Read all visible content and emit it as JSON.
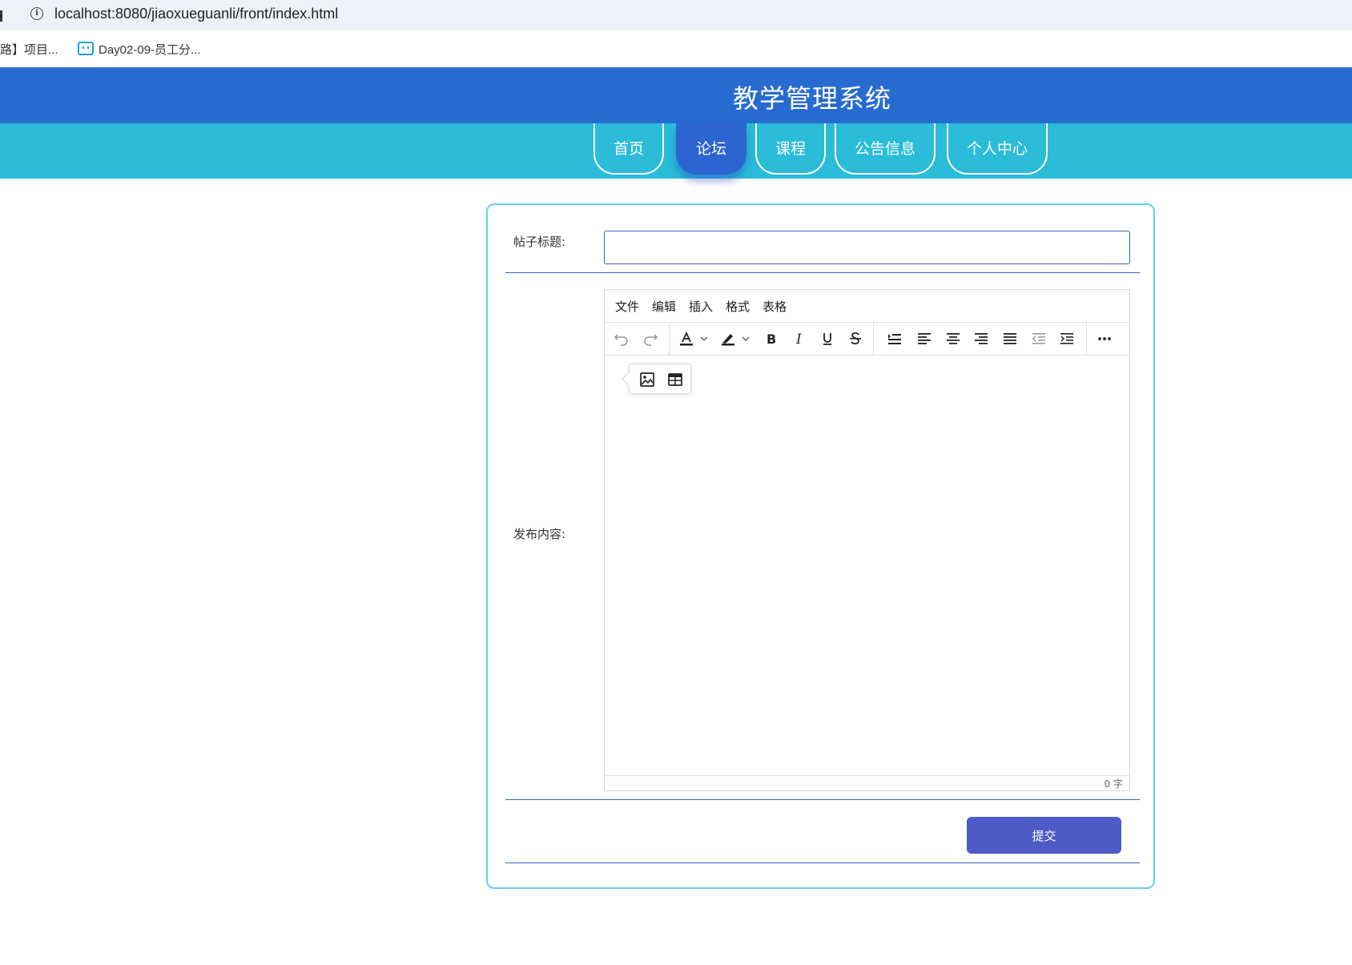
{
  "browser": {
    "url": "localhost:8080/jiaoxueguanli/front/index.html",
    "bookmarks": [
      {
        "label": "路】项目..."
      },
      {
        "label": "Day02-09-员工分..."
      }
    ]
  },
  "header": {
    "title": "教学管理系统"
  },
  "nav": {
    "items": [
      {
        "label": "首页"
      },
      {
        "label": "论坛"
      },
      {
        "label": "课程"
      },
      {
        "label": "公告信息"
      },
      {
        "label": "个人中心"
      }
    ],
    "active_index": 1
  },
  "form": {
    "title_label": "帖子标题:",
    "title_value": "",
    "content_label": "发布内容:",
    "submit_label": "提交"
  },
  "editor": {
    "menus": [
      "文件",
      "编辑",
      "插入",
      "格式",
      "表格"
    ],
    "toolbar_icons": [
      "undo-icon",
      "redo-icon",
      "text-color-icon",
      "chevron-down-icon",
      "highlight-color-icon",
      "chevron-down-icon",
      "bold-icon",
      "italic-icon",
      "underline-icon",
      "strikethrough-icon",
      "line-height-icon",
      "align-left-icon",
      "align-center-icon",
      "align-right-icon",
      "align-justify-icon",
      "outdent-icon",
      "indent-icon",
      "more-icon"
    ],
    "quickbar_icons": [
      "image-icon",
      "table-icon"
    ],
    "word_count": "0 字"
  },
  "colors": {
    "header_bg": "#276bd1",
    "nav_bg": "#2abcd8",
    "nav_active": "#2c65cf",
    "card_border": "#65d0e8",
    "divider": "#3d63c9",
    "submit_bg": "#4d5bc7"
  }
}
